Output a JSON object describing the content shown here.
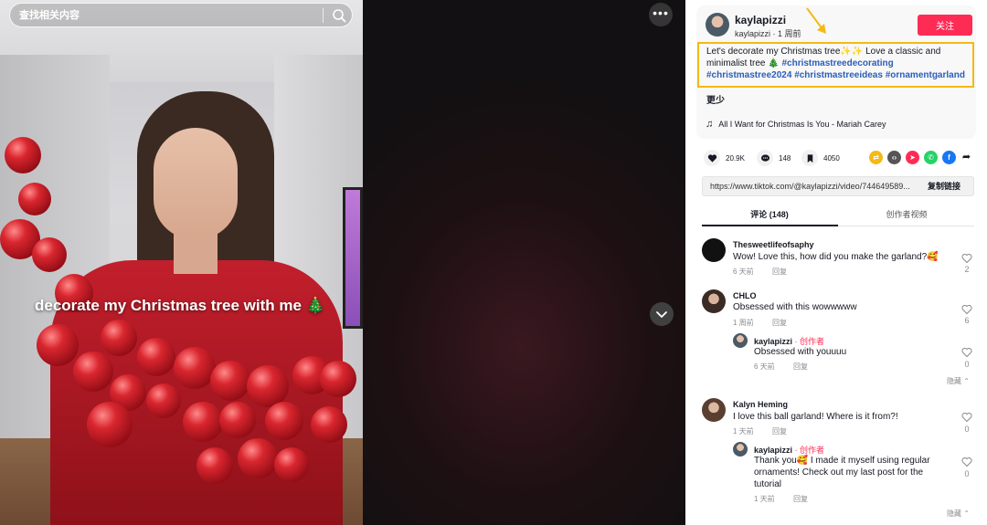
{
  "search": {
    "placeholder": "查找相关内容"
  },
  "video": {
    "caption": "decorate my Christmas tree with me 🎄"
  },
  "author": {
    "display_name": "kaylapizzi",
    "username": "kaylapizzi",
    "time_ago": "1 周前",
    "follow_label": "关注"
  },
  "description": {
    "text_line1": "Let's decorate my Christmas tree✨✨ Love a classic and minimalist tree 🎄",
    "hashtags": [
      "#christmastreedecorating",
      "#christmastree2024",
      "#christmastreeideas",
      "#ornamentgarland"
    ],
    "more_label": "更少"
  },
  "music": {
    "title": "All I Want for Christmas Is You - Mariah Carey"
  },
  "stats": {
    "likes": "20.9K",
    "comments": "148",
    "saves": "4050"
  },
  "share_colors": [
    "#f5b915",
    "#555555",
    "#fe2c55",
    "#25d366",
    "#1877f2"
  ],
  "link": {
    "url": "https://www.tiktok.com/@kaylapizzi/video/744649589...",
    "copy_label": "复制链接"
  },
  "tabs": {
    "comments": "评论 (148)",
    "creator_videos": "创作者视频"
  },
  "comments": [
    {
      "user": "Thesweetlifeofsaphy",
      "text": "Wow! Love this, how did you make the garland?🥰",
      "time": "6 天前",
      "reply": "回复",
      "likes": "2"
    },
    {
      "user": "CHLO",
      "text": "Obsessed with this wowwwww",
      "time": "1 周前",
      "reply": "回复",
      "likes": "6"
    },
    {
      "user": "kaylapizzi",
      "creator": "· 创作者",
      "text": "Obsessed with youuuu",
      "time": "6 天前",
      "reply": "回复",
      "likes": "0"
    },
    {
      "user": "Kalyn Heming",
      "text": "I love this ball garland! Where is it from?!",
      "time": "1 天前",
      "reply": "回复",
      "likes": "0"
    },
    {
      "user": "kaylapizzi",
      "creator": "· 创作者",
      "text": "Thank you🥰 I made it myself using regular ornaments! Check out my last post for the tutorial",
      "time": "1 天前",
      "reply": "回复",
      "likes": "0"
    }
  ],
  "hide_label": "隐藏 ⌃"
}
